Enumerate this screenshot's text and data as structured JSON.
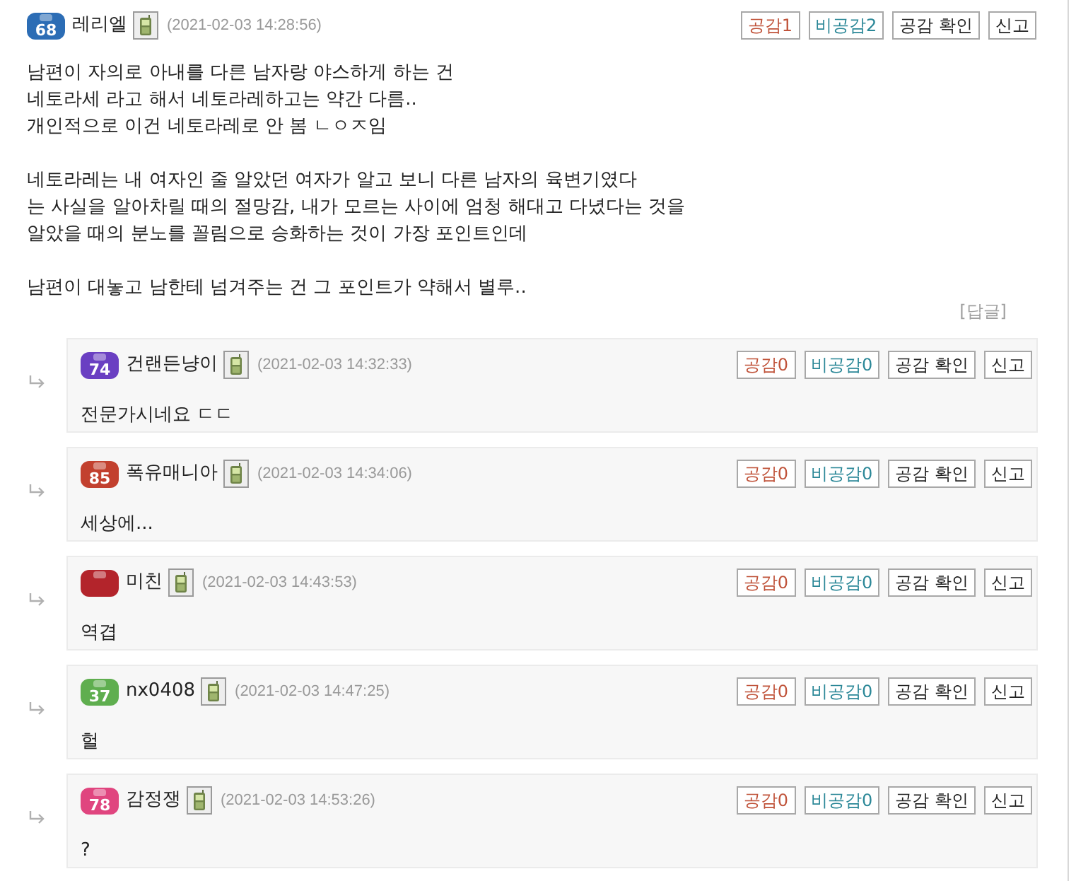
{
  "comment": {
    "badge": {
      "number": "68",
      "color": "#2c6db5"
    },
    "author": "레리엘",
    "mobile": true,
    "date": "(2021-02-03 14:28:56)",
    "actions": [
      {
        "kind": "like",
        "label": "공감1"
      },
      {
        "kind": "dislike",
        "label": "비공감2"
      },
      {
        "kind": "check",
        "label": "공감 확인"
      },
      {
        "kind": "report",
        "label": "신고"
      }
    ],
    "paragraphs": [
      "남편이 자의로 아내를 다른 남자랑 야스하게 하는 건\n네토라세 라고 해서 네토라레하고는 약간 다름..\n개인적으로 이건 네토라레로 안 봄 ㄴㅇㅈ임",
      "네토라레는 내 여자인 줄 알았던 여자가 알고 보니 다른 남자의 육변기였다\n는 사실을 알아차릴 때의 절망감, 내가 모르는 사이에 엄청 해대고 다녔다는 것을\n알았을 때의 분노를 꼴림으로 승화하는 것이 가장 포인트인데",
      "남편이 대놓고 남한테 넘겨주는 건 그 포인트가 약해서 별루.."
    ],
    "reply_link": "[답글]"
  },
  "replies": [
    {
      "badge": {
        "number": "74",
        "color": "#6a3fc2"
      },
      "author": "건랜든냥이",
      "mobile": true,
      "date": "(2021-02-03 14:32:33)",
      "actions": [
        {
          "kind": "like",
          "label": "공감0"
        },
        {
          "kind": "dislike",
          "label": "비공감0"
        },
        {
          "kind": "check",
          "label": "공감 확인"
        },
        {
          "kind": "report",
          "label": "신고"
        }
      ],
      "text": "전문가시네요 ㄷㄷ"
    },
    {
      "badge": {
        "number": "85",
        "color": "#c2402e"
      },
      "author": "폭유매니아",
      "mobile": true,
      "date": "(2021-02-03 14:34:06)",
      "actions": [
        {
          "kind": "like",
          "label": "공감0"
        },
        {
          "kind": "dislike",
          "label": "비공감0"
        },
        {
          "kind": "check",
          "label": "공감 확인"
        },
        {
          "kind": "report",
          "label": "신고"
        }
      ],
      "text": "세상에..."
    },
    {
      "badge": {
        "color": "#b3242b"
      },
      "author": "미친",
      "mobile": true,
      "date": "(2021-02-03 14:43:53)",
      "actions": [
        {
          "kind": "like",
          "label": "공감0"
        },
        {
          "kind": "dislike",
          "label": "비공감0"
        },
        {
          "kind": "check",
          "label": "공감 확인"
        },
        {
          "kind": "report",
          "label": "신고"
        }
      ],
      "text": "역겹"
    },
    {
      "badge": {
        "number": "37",
        "color": "#5fae4f"
      },
      "author": "nx0408",
      "mobile": true,
      "date": "(2021-02-03 14:47:25)",
      "actions": [
        {
          "kind": "like",
          "label": "공감0"
        },
        {
          "kind": "dislike",
          "label": "비공감0"
        },
        {
          "kind": "check",
          "label": "공감 확인"
        },
        {
          "kind": "report",
          "label": "신고"
        }
      ],
      "text": "헐"
    },
    {
      "badge": {
        "number": "78",
        "color": "#e0457f"
      },
      "author": "감정쟁",
      "mobile": true,
      "date": "(2021-02-03 14:53:26)",
      "actions": [
        {
          "kind": "like",
          "label": "공감0"
        },
        {
          "kind": "dislike",
          "label": "비공감0"
        },
        {
          "kind": "check",
          "label": "공감 확인"
        },
        {
          "kind": "report",
          "label": "신고"
        }
      ],
      "text": "?"
    }
  ]
}
